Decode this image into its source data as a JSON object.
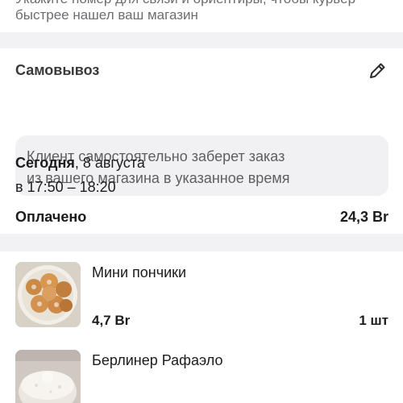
{
  "address_hint": {
    "line1": "Укажите номер для связи и ориентиры, чтобы курьер",
    "line2": "быстрее нашел ваш магазин"
  },
  "pickup": {
    "title": "Самовывоз",
    "edit_icon": "pencil-icon",
    "notice_line1": "Клиент самостоятельно заберет заказ",
    "notice_line2": "из вашего магазина в указанное время",
    "day_label": "Сегодня",
    "date_rest": ", 8 августа",
    "time_range": "в 17:50 – 18:20"
  },
  "payment": {
    "status_label": "Оплачено",
    "total": "24,3 Br"
  },
  "items": [
    {
      "name": "Мини пончики",
      "price": "4,7 Br",
      "quantity": "1 шт"
    },
    {
      "name": "Берлинер Рафаэло"
    }
  ]
}
